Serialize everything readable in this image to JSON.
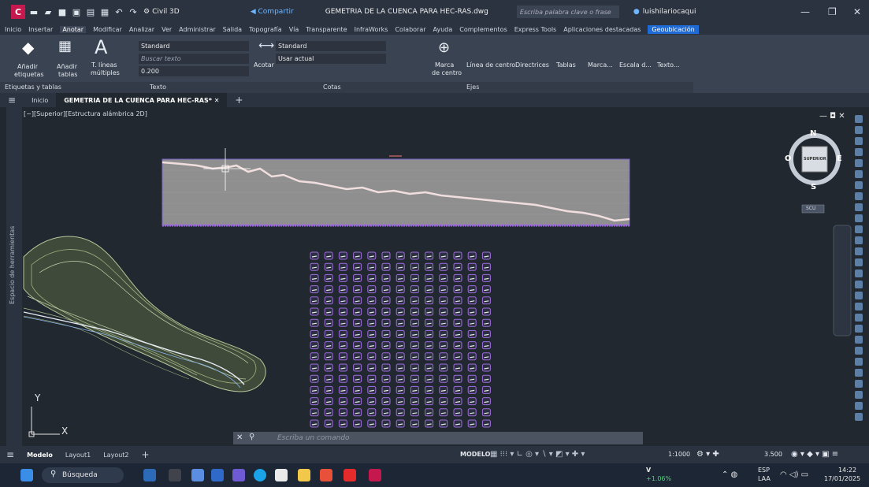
{
  "titlebar": {
    "app_logo": "C",
    "workspace": "Civil 3D",
    "share": "Compartir",
    "document_title": "GEMETRIA DE LA CUENCA PARA HEC-RAS.dwg",
    "search_placeholder": "Escriba palabra clave o frase",
    "user": "luishilariocaqui"
  },
  "menu": [
    "Inicio",
    "Insertar",
    "Anotar",
    "Modificar",
    "Analizar",
    "Ver",
    "Administrar",
    "Salida",
    "Topografía",
    "Vía",
    "Transparente",
    "InfraWorks",
    "Colaborar",
    "Ayuda",
    "Complementos",
    "Express Tools",
    "Aplicaciones destacadas",
    "Geoubicación"
  ],
  "ribbon": {
    "add_labels": "Añadir etiquetas",
    "add_labels_1": "Añadir",
    "add_labels_2": "etiquetas",
    "add_tables_1": "Añadir",
    "add_tables_2": "tablas",
    "mtext_1": "T. líneas",
    "mtext_2": "múltiples",
    "text_style": "Standard",
    "search_text": "Buscar texto",
    "text_height": "0.200",
    "dim_style": "Standard",
    "use_current": "Usar actual",
    "acotar": "Acotar",
    "marca_1": "Marca",
    "marca_2": "de centro",
    "linea_centro": "Línea de centro",
    "directrices": "Directrices",
    "tablas": "Tablas",
    "marca_d": "Marca...",
    "escala": "Escala d...",
    "texto": "Texto...",
    "panel_etiquetas": "Etiquetas y tablas",
    "panel_texto": "Texto",
    "panel_cotas": "Cotas",
    "panel_ejes": "Ejes"
  },
  "filetabs": {
    "home": "Inicio",
    "current": "GEMETRIA DE LA CUENCA PARA HEC-RAS*"
  },
  "canvas": {
    "view_label": "[−][Superior][Estructura alámbrica 2D]",
    "side_panel": "Espacio de herramientas",
    "compass_n": "N",
    "compass_s": "S",
    "compass_e": "E",
    "compass_o": "O",
    "cube_face": "SUPERIOR",
    "ucs": "SCU",
    "axis_y": "Y",
    "axis_x": "X",
    "command_placeholder": "Escriba un comando"
  },
  "layout": {
    "tabs": [
      "Modelo",
      "Layout1",
      "Layout2"
    ],
    "model": "MODELO",
    "scale": "1:1000",
    "value": "3.500"
  },
  "taskbar": {
    "search": "Búsqueda",
    "stock": "V",
    "stock_change": "+1.06%",
    "lang_1": "ESP",
    "lang_2": "LAA",
    "time": "14:22",
    "date": "17/01/2025"
  },
  "colors": {
    "accent": "#1e6bd6",
    "logo": "#c5184f",
    "profile_fill": "#9a9a9a",
    "grid_stroke": "#a16be0"
  }
}
